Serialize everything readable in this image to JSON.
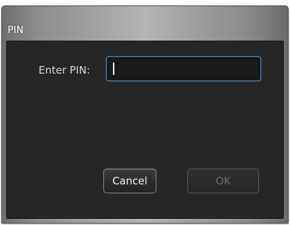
{
  "window": {
    "title": "PIN"
  },
  "form": {
    "pin_label": "Enter PIN:",
    "pin_value": "",
    "pin_placeholder": ""
  },
  "buttons": {
    "cancel_label": "Cancel",
    "ok_label": "OK",
    "ok_enabled": false
  },
  "colors": {
    "window_background": "#262626",
    "input_focus_border": "#4a8fd0",
    "button_disabled_text": "#6e6e6e"
  }
}
